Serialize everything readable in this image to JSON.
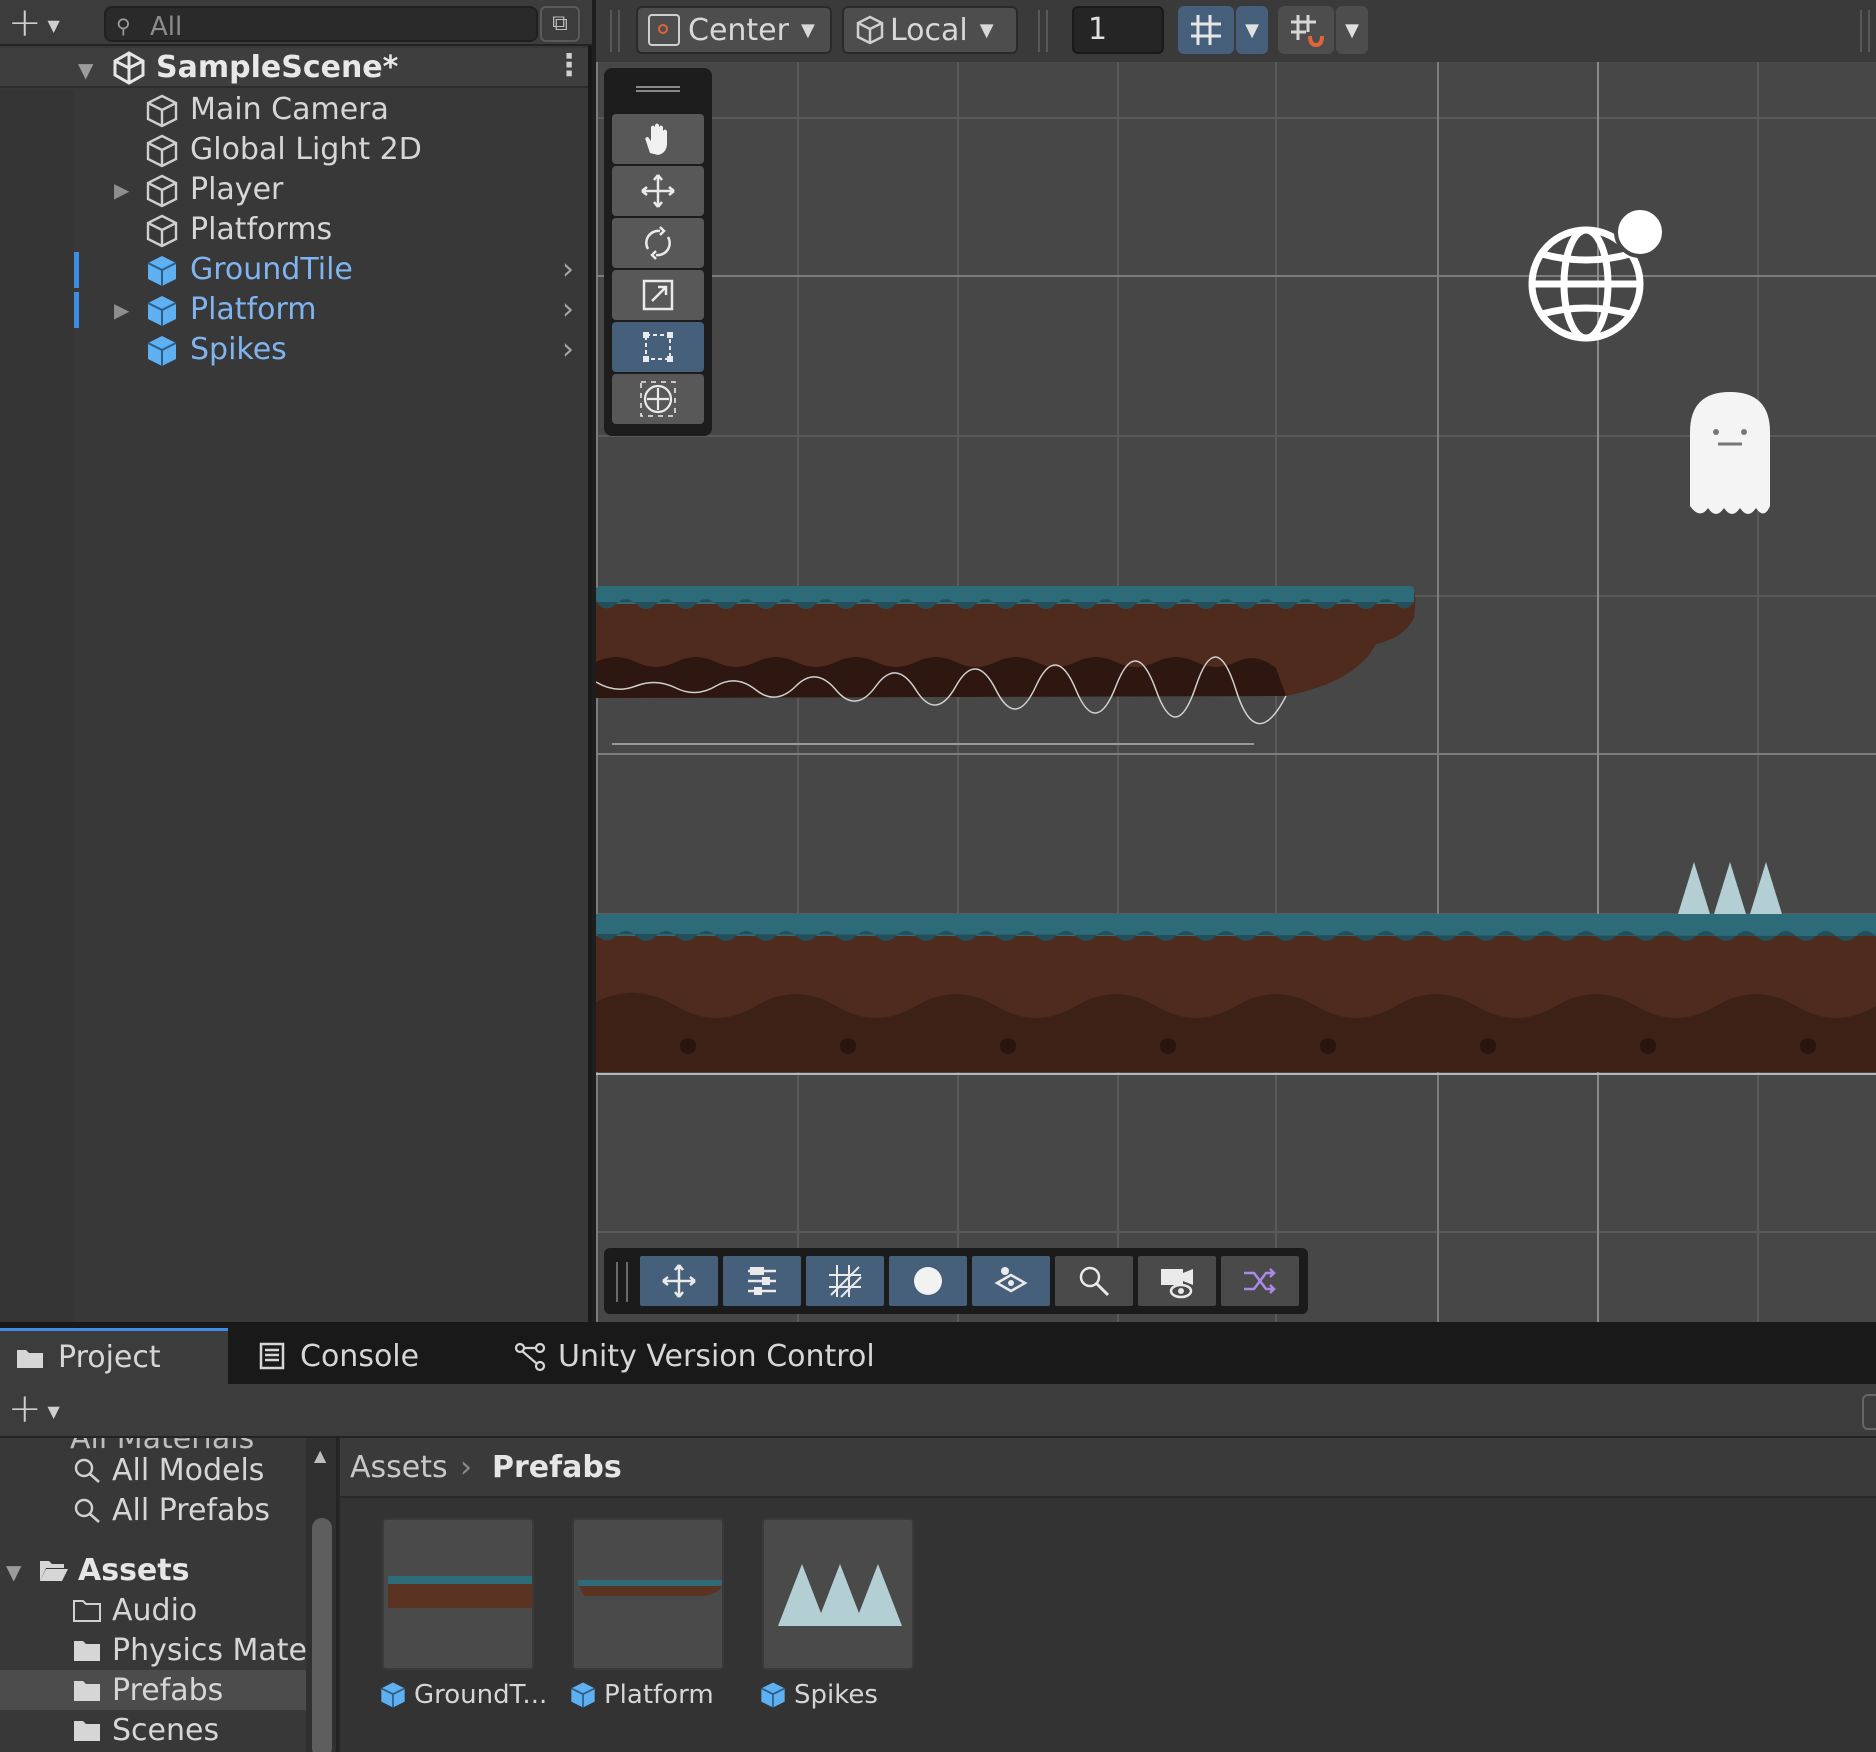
{
  "colors": {
    "accent": "#3c8de3",
    "prefab_text": "#7fb4ef",
    "prefab_icon": "#5fb0f0",
    "active_tool": "#46607c",
    "scene_bg": "#474747",
    "ground_top": "#2e6b78",
    "ground_dirt": "#5b3322"
  },
  "hierarchy": {
    "add_icon": "plus-icon",
    "search": {
      "placeholder": "All",
      "icon": "search-icon"
    },
    "scene": {
      "title": "SampleScene*",
      "icon": "unity-logo-icon"
    },
    "items": [
      {
        "label": "Main Camera",
        "type": "gameobject",
        "icon": "cube-outline-icon"
      },
      {
        "label": "Global Light 2D",
        "type": "gameobject",
        "icon": "cube-outline-icon"
      },
      {
        "label": "Player",
        "type": "gameobject",
        "icon": "cube-outline-icon",
        "collapsed": true
      },
      {
        "label": "Platforms",
        "type": "gameobject",
        "icon": "cube-outline-icon"
      },
      {
        "label": "GroundTile",
        "type": "prefab",
        "icon": "prefab-cube-icon",
        "marked": true
      },
      {
        "label": "Platform",
        "type": "prefab",
        "icon": "prefab-cube-icon",
        "marked": true,
        "collapsed": true
      },
      {
        "label": "Spikes",
        "type": "prefab",
        "icon": "prefab-cube-icon"
      }
    ]
  },
  "scene_toolbar": {
    "pivot_mode": "Center",
    "pivot_rotation": "Local",
    "snap_increment": "1",
    "grid_snap_icon": "grid-snap-icon",
    "snap_settings_icon": "snap-settings-icon"
  },
  "tools": [
    "hand-tool",
    "move-tool",
    "rotate-tool",
    "scale-tool",
    "rect-tool",
    "transform-tool"
  ],
  "active_tool": "rect-tool",
  "overlay_toolbar": [
    "move-overlay",
    "sliders-overlay",
    "grid-overlay",
    "shading-overlay",
    "layers-overlay",
    "search-overlay",
    "camera-overlay",
    "shuffle-overlay"
  ],
  "bottom_tabs": [
    {
      "label": "Project",
      "icon": "folder-icon",
      "active": true
    },
    {
      "label": "Console",
      "icon": "console-icon",
      "active": false
    },
    {
      "label": "Unity Version Control",
      "icon": "branch-icon",
      "active": false
    }
  ],
  "project_sidebar": {
    "cut_off_item": "All Materials",
    "search_items": [
      "All Models",
      "All Prefabs"
    ],
    "root": "Assets",
    "folders": [
      "Audio",
      "Physics Mate",
      "Prefabs",
      "Scenes"
    ],
    "selected_folder": "Prefabs"
  },
  "breadcrumb": {
    "root": "Assets",
    "current": "Prefabs"
  },
  "assets": [
    {
      "label": "GroundT...",
      "kind": "groundtile"
    },
    {
      "label": "Platform",
      "kind": "platform"
    },
    {
      "label": "Spikes",
      "kind": "spikes"
    }
  ]
}
